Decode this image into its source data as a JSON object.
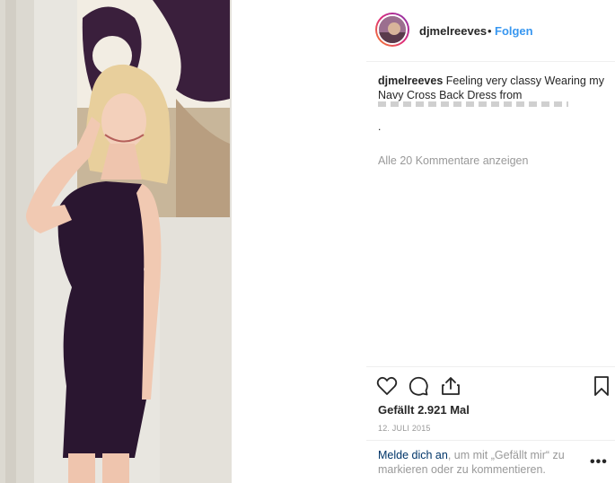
{
  "post": {
    "username": "djmelreeves",
    "separator": "•",
    "follow_label": "Folgen",
    "caption_user": "djmelreeves",
    "caption_text": " Feeling very classy Wearing my Navy Cross Back Dress from",
    "caption_period": ".",
    "view_comments": "Alle 20 Kommentare anzeigen",
    "likes": "Gefällt 2.921 Mal",
    "date": "12. JULI 2015",
    "login_link": "Melde dich an",
    "login_rest": ", um mit „Gefällt mir“ zu markieren oder zu kommentieren.",
    "more_options": "•••"
  },
  "icons": [
    "heart-icon",
    "comment-icon",
    "share-icon",
    "bookmark-icon",
    "more-options-icon"
  ],
  "colors": {
    "link_blue": "#3897f0",
    "login_link": "#003569",
    "muted": "#999999",
    "dress": "#2a1630"
  }
}
